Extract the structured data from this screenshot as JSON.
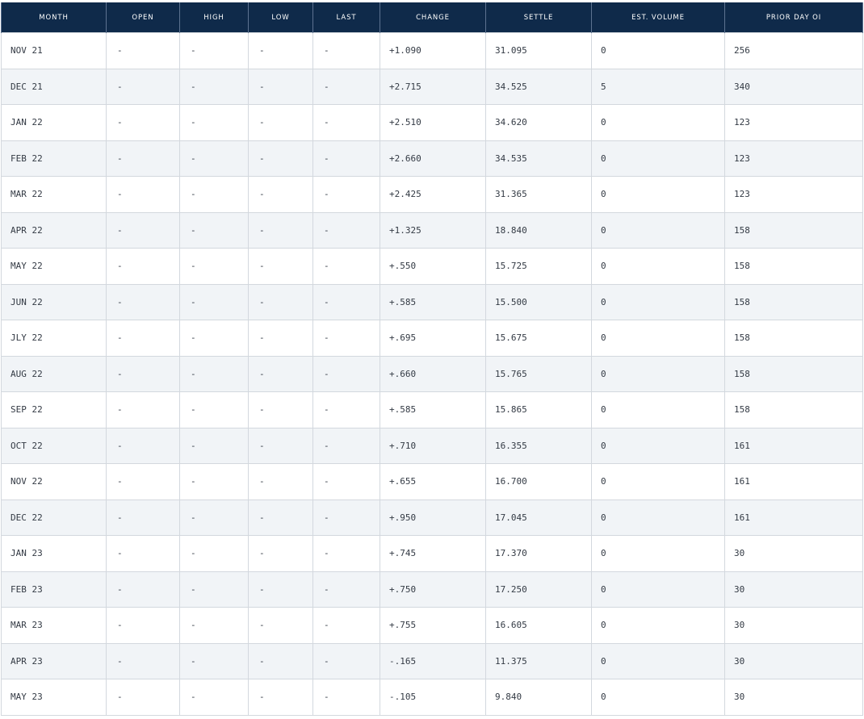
{
  "table": {
    "headers": [
      "MONTH",
      "OPEN",
      "HIGH",
      "LOW",
      "LAST",
      "CHANGE",
      "SETTLE",
      "EST. VOLUME",
      "PRIOR DAY OI"
    ],
    "rows": [
      [
        "NOV 21",
        "-",
        "-",
        "-",
        "-",
        "+1.090",
        "31.095",
        "0",
        "256"
      ],
      [
        "DEC 21",
        "-",
        "-",
        "-",
        "-",
        "+2.715",
        "34.525",
        "5",
        "340"
      ],
      [
        "JAN 22",
        "-",
        "-",
        "-",
        "-",
        "+2.510",
        "34.620",
        "0",
        "123"
      ],
      [
        "FEB 22",
        "-",
        "-",
        "-",
        "-",
        "+2.660",
        "34.535",
        "0",
        "123"
      ],
      [
        "MAR 22",
        "-",
        "-",
        "-",
        "-",
        "+2.425",
        "31.365",
        "0",
        "123"
      ],
      [
        "APR 22",
        "-",
        "-",
        "-",
        "-",
        "+1.325",
        "18.840",
        "0",
        "158"
      ],
      [
        "MAY 22",
        "-",
        "-",
        "-",
        "-",
        "+.550",
        "15.725",
        "0",
        "158"
      ],
      [
        "JUN 22",
        "-",
        "-",
        "-",
        "-",
        "+.585",
        "15.500",
        "0",
        "158"
      ],
      [
        "JLY 22",
        "-",
        "-",
        "-",
        "-",
        "+.695",
        "15.675",
        "0",
        "158"
      ],
      [
        "AUG 22",
        "-",
        "-",
        "-",
        "-",
        "+.660",
        "15.765",
        "0",
        "158"
      ],
      [
        "SEP 22",
        "-",
        "-",
        "-",
        "-",
        "+.585",
        "15.865",
        "0",
        "158"
      ],
      [
        "OCT 22",
        "-",
        "-",
        "-",
        "-",
        "+.710",
        "16.355",
        "0",
        "161"
      ],
      [
        "NOV 22",
        "-",
        "-",
        "-",
        "-",
        "+.655",
        "16.700",
        "0",
        "161"
      ],
      [
        "DEC 22",
        "-",
        "-",
        "-",
        "-",
        "+.950",
        "17.045",
        "0",
        "161"
      ],
      [
        "JAN 23",
        "-",
        "-",
        "-",
        "-",
        "+.745",
        "17.370",
        "0",
        "30"
      ],
      [
        "FEB 23",
        "-",
        "-",
        "-",
        "-",
        "+.750",
        "17.250",
        "0",
        "30"
      ],
      [
        "MAR 23",
        "-",
        "-",
        "-",
        "-",
        "+.755",
        "16.605",
        "0",
        "30"
      ],
      [
        "APR 23",
        "-",
        "-",
        "-",
        "-",
        "-.165",
        "11.375",
        "0",
        "30"
      ],
      [
        "MAY 23",
        "-",
        "-",
        "-",
        "-",
        "-.105",
        "9.840",
        "0",
        "30"
      ]
    ]
  },
  "colors": {
    "header_bg": "#0f2a4a",
    "header_text": "#ffffff",
    "row_alt_bg": "#f1f4f7",
    "border": "#d3d8de"
  }
}
